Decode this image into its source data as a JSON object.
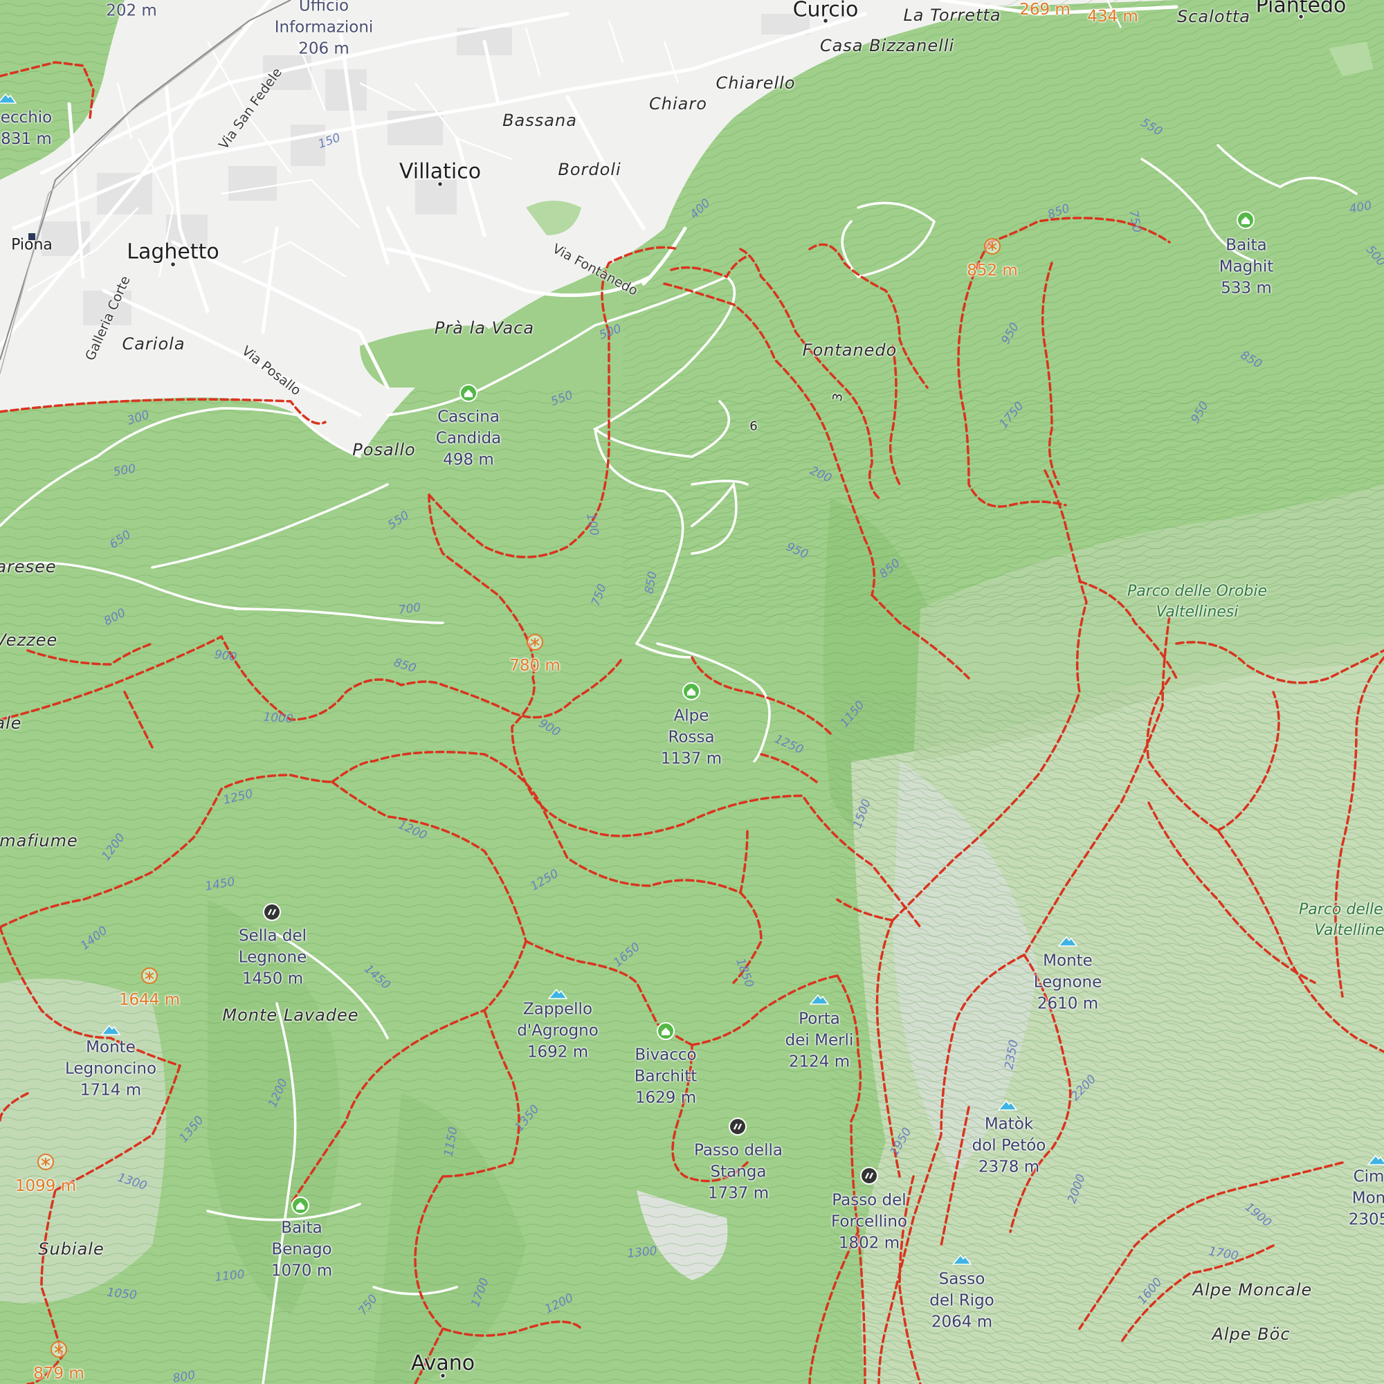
{
  "colors": {
    "forest": "#9ecf88",
    "forest_dark": "#86bf70",
    "meadow": "#c9dfbc",
    "rock": "#d9e0d6",
    "urban": "#f3f3f3",
    "trail": "#d9341f",
    "road": "#ffffff",
    "contour": "#5e9a52",
    "peak_icon": "#3fb4e4",
    "hut_icon": "#54b847",
    "pass_icon": "#333333",
    "view_icon": "#e07a25"
  },
  "settlements": {
    "curcio": "Curcio",
    "piantedo": "Piantedo",
    "villatico": "Villatico",
    "laghetto": "Laghetto",
    "piona": "Piona",
    "avano": "Avano"
  },
  "hamlets": {
    "la_torretta": "La Torretta",
    "scalotta": "Scalotta",
    "casa_bizzanelli": "Casa Bizzanelli",
    "chiarello": "Chiarello",
    "chiaro": "Chiaro",
    "bassana": "Bassana",
    "bordoli": "Bordoli",
    "pra_la_vaca": "Prà la Vaca",
    "cariola": "Cariola",
    "posallo": "Posallo",
    "fontanedo": "Fontanedo",
    "monte_lavadee": "Monte Lavadee",
    "subiale": "Subiale",
    "alpe_moncale": "Alpe Moncale",
    "alpe_boc": "Alpe Böc",
    "aresee": "aresee",
    "vezzee": "Vezzee",
    "mafiume": "mafiume",
    "ale": "ale"
  },
  "streets": {
    "via_san_fedele": "Via San Fedele",
    "galleria_corte": "Galleria Corte",
    "via_posallo": "Via Posallo",
    "via_fontanedo": "Via Fontanedo"
  },
  "info_point": {
    "line1": "Ufficio",
    "line2": "Informazioni",
    "elev": "206 m"
  },
  "park": {
    "line1": "Parco delle Orobie",
    "line2": "Valtellinesi",
    "line1b": "Parco delle O",
    "line2b": "Valtelline"
  },
  "peaks": {
    "zappello": {
      "l1": "Zappello",
      "l2": "d'Agrogno",
      "elev": "1692 m"
    },
    "porta_merli": {
      "l1": "Porta",
      "l2": "dei Merli",
      "elev": "2124 m"
    },
    "monte_legnone": {
      "l1": "Monte",
      "l2": "Legnone",
      "elev": "2610 m"
    },
    "matok": {
      "l1": "Matòk",
      "l2": "dol Petóo",
      "elev": "2378 m"
    },
    "sasso_rigo": {
      "l1": "Sasso",
      "l2": "del Rigo",
      "elev": "2064 m"
    },
    "legnoncino": {
      "l1": "Monte",
      "l2": "Legnoncino",
      "elev": "1714 m"
    },
    "cima": {
      "l1": "Cim",
      "l2": "Mon",
      "elev": "2305"
    },
    "cecchio": {
      "l1": "ecchio",
      "elev": "831 m"
    }
  },
  "huts": {
    "cascina": {
      "l1": "Cascina",
      "l2": "Candida",
      "elev": "498 m"
    },
    "alpe_rossa": {
      "l1": "Alpe",
      "l2": "Rossa",
      "elev": "1137 m"
    },
    "baita_maghit": {
      "l1": "Baita",
      "l2": "Maghit",
      "elev": "533 m"
    },
    "bivacco": {
      "l1": "Bivacco",
      "l2": "Barchitt",
      "elev": "1629 m"
    },
    "baita_benago": {
      "l1": "Baita",
      "l2": "Benago",
      "elev": "1070 m"
    }
  },
  "passes": {
    "sella": {
      "l1": "Sella del",
      "l2": "Legnone",
      "elev": "1450 m"
    },
    "stanga": {
      "l1": "Passo della",
      "l2": "Stanga",
      "elev": "1737 m"
    },
    "forcellino": {
      "l1": "Passo del",
      "l2": "Forcellino",
      "elev": "1802 m"
    }
  },
  "viewpoints": {
    "v852": "852 m",
    "v780": "780 m",
    "v1644": "1644 m",
    "v1099": "1099 m",
    "v879": "879 m",
    "v269": "269 m",
    "v434": "434 m"
  },
  "misc_elev": {
    "e202": "202 m"
  },
  "contours": {
    "c150": "150",
    "c300": "300",
    "c500": "500",
    "c500b": "500",
    "c550": "550",
    "c550b": "550",
    "c650": "650",
    "c700": "700",
    "c800": "800",
    "c900": "900",
    "c850": "850",
    "c1000": "1000",
    "c1250": "1250",
    "c1200": "1200",
    "c1200b": "1200",
    "c1250b": "1250",
    "c1450": "1450",
    "c1400": "1400",
    "c1450b": "1450",
    "c1650": "1650",
    "c1850": "1850",
    "c1350": "1350",
    "c1300": "1300",
    "c1200c": "1200",
    "c1350b": "1350",
    "c1150": "1150",
    "c1100": "1100",
    "c1050": "1050",
    "c750": "750",
    "c800b": "800",
    "c1700": "1700",
    "c1200d": "1200",
    "c1300b": "1300",
    "c100": "100",
    "c750b": "750",
    "c850b": "850",
    "c900b": "900",
    "c950": "950",
    "c850c": "850",
    "c1150b": "1150",
    "c1250c": "1250",
    "c1500": "1500",
    "c400": "400",
    "c850d": "850",
    "c950b": "950",
    "c750c": "750",
    "c1750": "1750",
    "c550c": "550",
    "c850e": "850",
    "c950c": "950",
    "c400b": "400",
    "c500c": "500",
    "c2350": "2350",
    "c2200": "2200",
    "c1950": "1950",
    "c2000": "2000",
    "c1900": "1900",
    "c1700b": "1700",
    "c1600": "1600",
    "c200": "200"
  },
  "trail_numbers": {
    "t3": "3",
    "t6": "6"
  }
}
